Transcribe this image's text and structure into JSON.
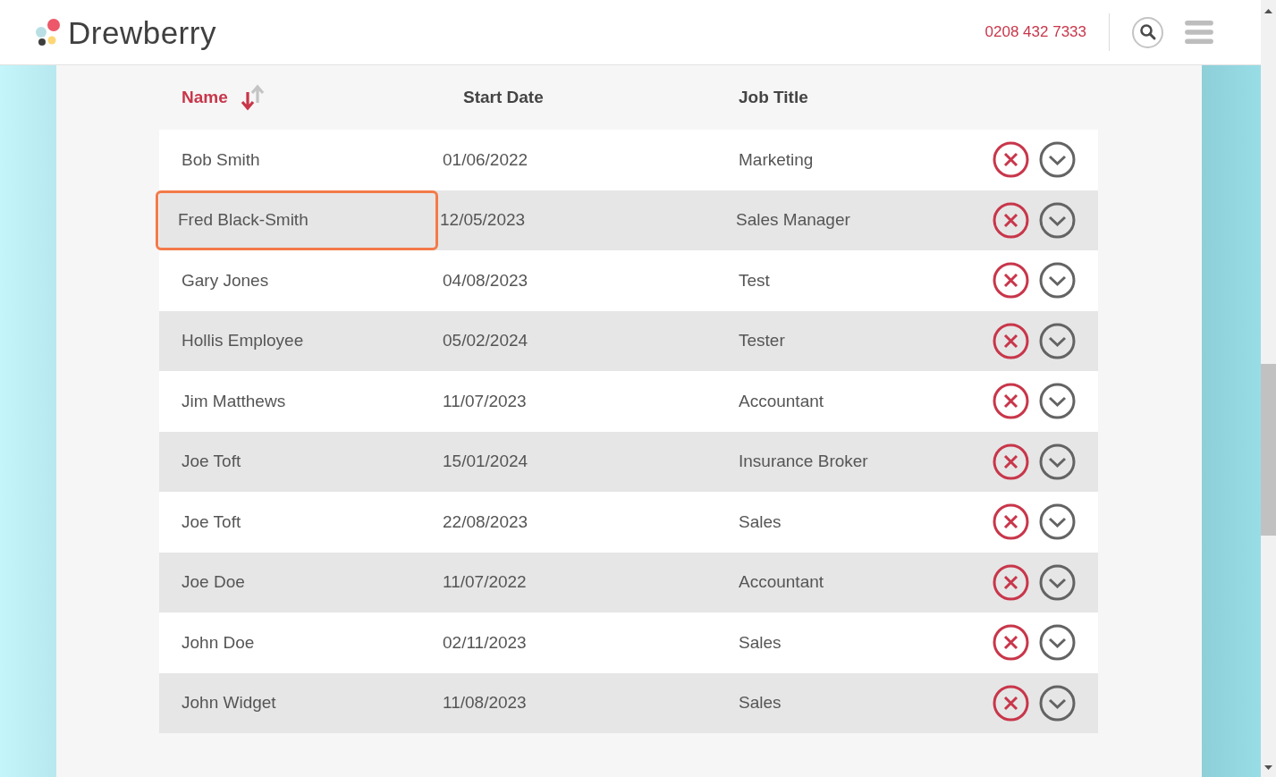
{
  "header": {
    "logo_text": "Drewberry",
    "phone": "0208 432 7333"
  },
  "table": {
    "columns": [
      {
        "label": "Name",
        "sorted": true
      },
      {
        "label": "Start Date",
        "sorted": false
      },
      {
        "label": "Job Title",
        "sorted": false
      }
    ],
    "rows": [
      {
        "name": "Bob Smith",
        "start_date": "01/06/2022",
        "job_title": "Marketing",
        "highlighted": false
      },
      {
        "name": "Fred Black-Smith",
        "start_date": "12/05/2023",
        "job_title": "Sales Manager",
        "highlighted": true
      },
      {
        "name": "Gary Jones",
        "start_date": "04/08/2023",
        "job_title": "Test",
        "highlighted": false
      },
      {
        "name": "Hollis Employee",
        "start_date": "05/02/2024",
        "job_title": "Tester",
        "highlighted": false
      },
      {
        "name": "Jim Matthews",
        "start_date": "11/07/2023",
        "job_title": "Accountant",
        "highlighted": false
      },
      {
        "name": "Joe Toft",
        "start_date": "15/01/2024",
        "job_title": "Insurance Broker",
        "highlighted": false
      },
      {
        "name": "Joe Toft",
        "start_date": "22/08/2023",
        "job_title": "Sales",
        "highlighted": false
      },
      {
        "name": "Joe Doe",
        "start_date": "11/07/2022",
        "job_title": "Accountant",
        "highlighted": false
      },
      {
        "name": "John Doe",
        "start_date": "02/11/2023",
        "job_title": "Sales",
        "highlighted": false
      },
      {
        "name": "John Widget",
        "start_date": "11/08/2023",
        "job_title": "Sales",
        "highlighted": false
      }
    ]
  }
}
